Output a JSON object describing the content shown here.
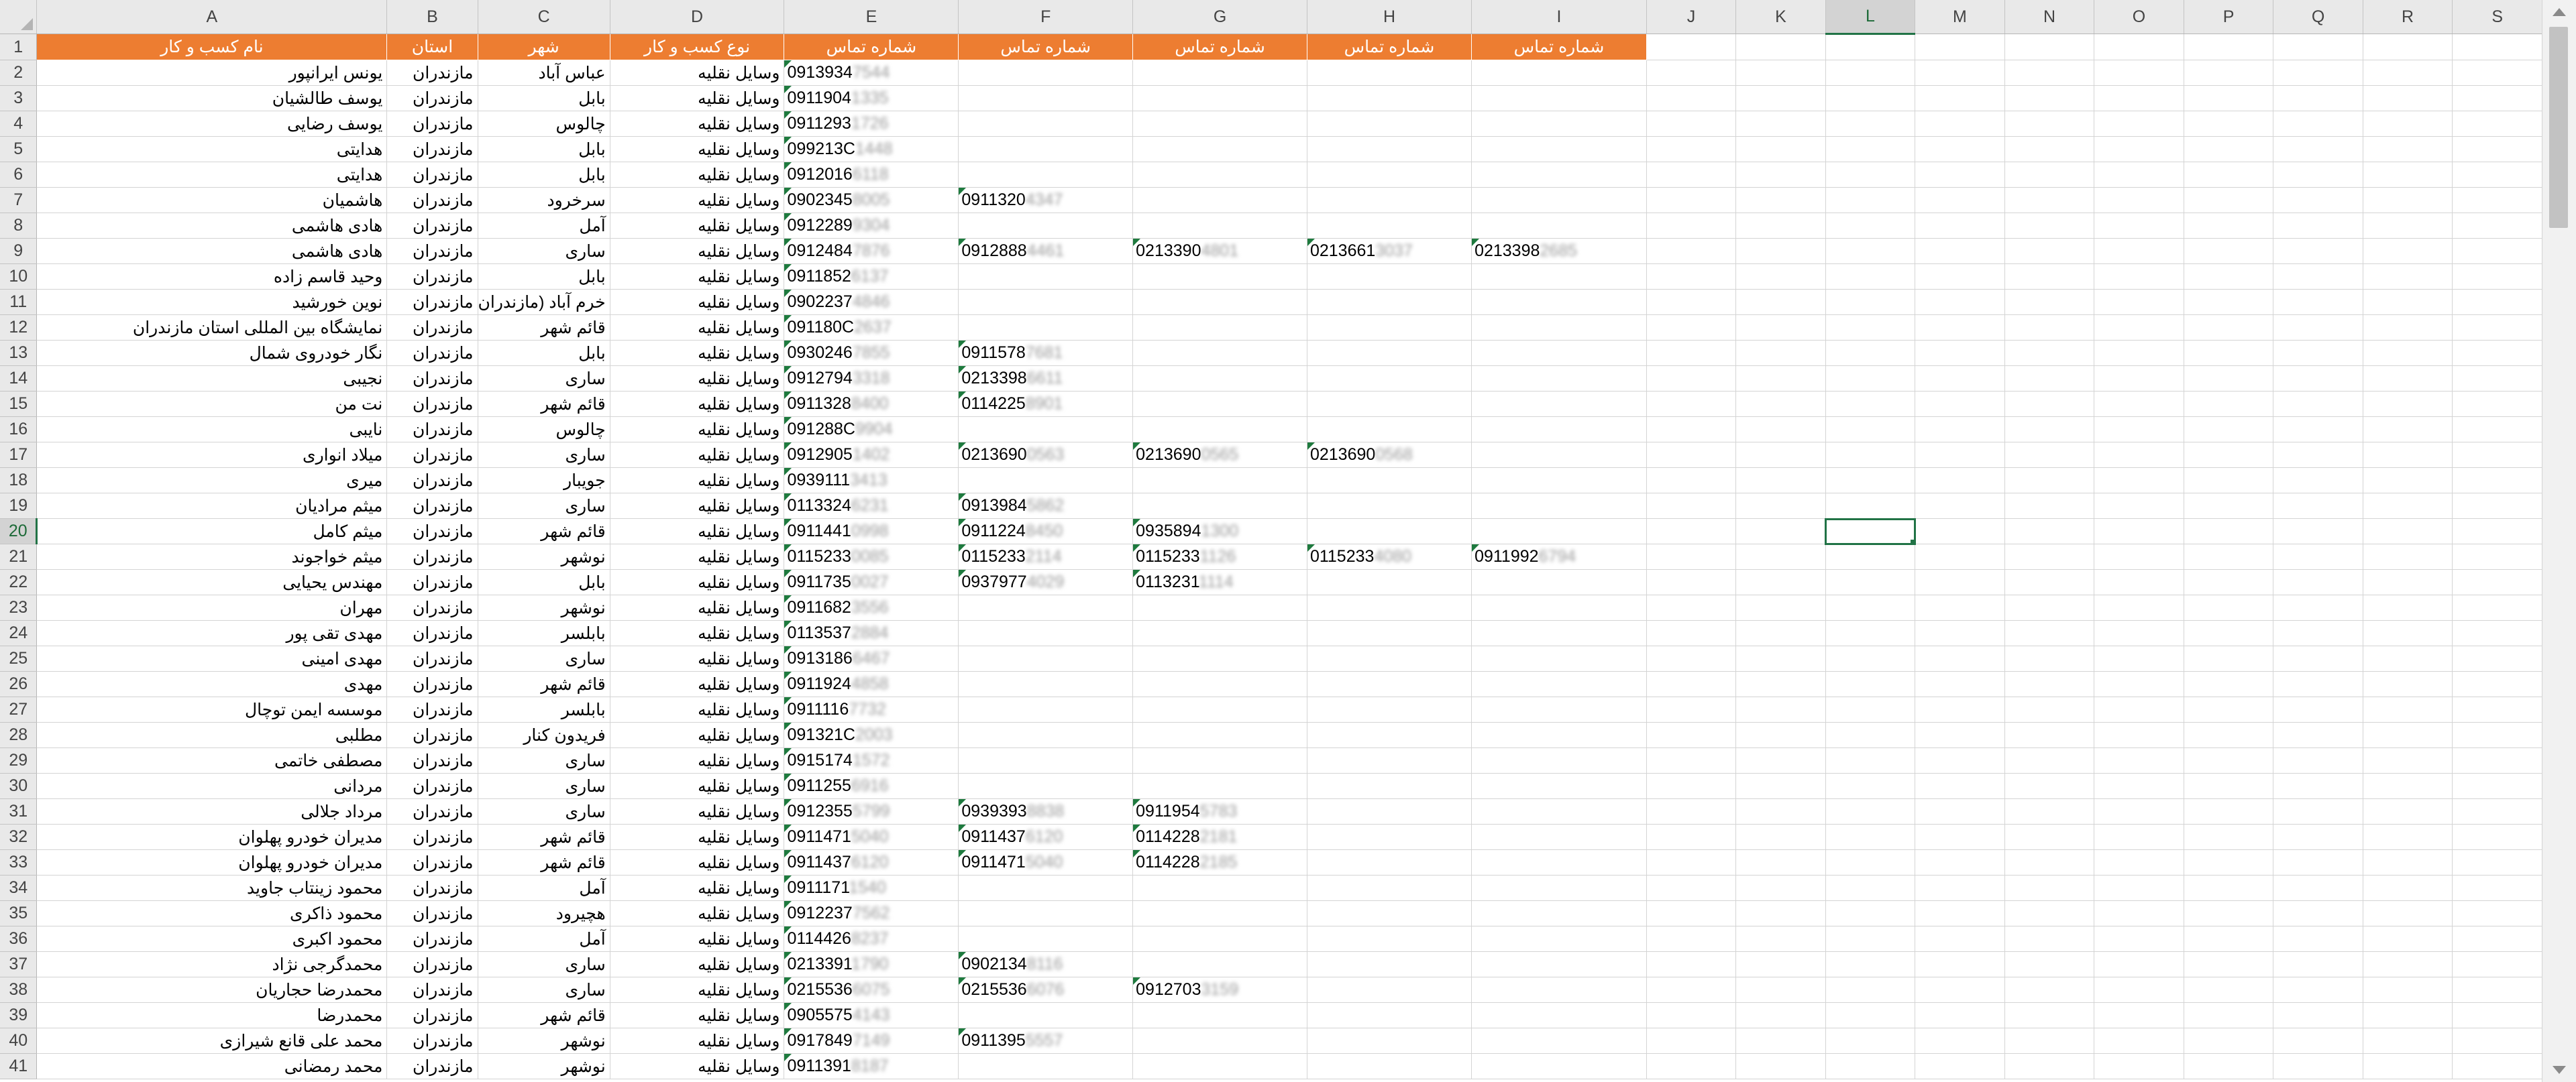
{
  "columns": [
    "A",
    "B",
    "C",
    "D",
    "E",
    "F",
    "G",
    "H",
    "I",
    "J",
    "K",
    "L",
    "M",
    "N",
    "O",
    "P",
    "Q",
    "R",
    "S"
  ],
  "active_column": "L",
  "active_row": "20",
  "header_row": {
    "A": "نام کسب و کار",
    "B": "استان",
    "C": "شهر",
    "D": "نوع کسب و کار",
    "E": "شماره تماس",
    "F": "شماره تماس",
    "G": "شماره تماس",
    "H": "شماره تماس",
    "I": "شماره تماس"
  },
  "rows": [
    {
      "n": "2",
      "A": "یونس ایرانپور",
      "B": "مازندران",
      "C": "عباس آباد",
      "D": "وسایل نقلیه",
      "E": "0913934",
      "Eb": "7544"
    },
    {
      "n": "3",
      "A": "یوسف طالشیان",
      "B": "مازندران",
      "C": "بابل",
      "D": "وسایل نقلیه",
      "E": "0911904",
      "Eb": "1335"
    },
    {
      "n": "4",
      "A": "یوسف رضایی",
      "B": "مازندران",
      "C": "چالوس",
      "D": "وسایل نقلیه",
      "E": "0911293",
      "Eb": "1726"
    },
    {
      "n": "5",
      "A": "هدایتی",
      "B": "مازندران",
      "C": "بابل",
      "D": "وسایل نقلیه",
      "E": "099213C",
      "Eb": "1448"
    },
    {
      "n": "6",
      "A": "هدایتی",
      "B": "مازندران",
      "C": "بابل",
      "D": "وسایل نقلیه",
      "E": "0912016",
      "Eb": "6118"
    },
    {
      "n": "7",
      "A": "هاشمیان",
      "B": "مازندران",
      "C": "سرخرود",
      "D": "وسایل نقلیه",
      "E": "0902345",
      "Eb": "8005",
      "F": "0911320",
      "Fb": "4347"
    },
    {
      "n": "8",
      "A": "هادی هاشمی",
      "B": "مازندران",
      "C": "آمل",
      "D": "وسایل نقلیه",
      "E": "0912289",
      "Eb": "9304"
    },
    {
      "n": "9",
      "A": "هادی هاشمی",
      "B": "مازندران",
      "C": "ساری",
      "D": "وسایل نقلیه",
      "E": "0912484",
      "Eb": "7876",
      "F": "0912888",
      "Fb": "4461",
      "G": "0213390",
      "Gb": "4801",
      "H": "0213661",
      "Hb": "3037",
      "I": "0213398",
      "Ib": "2685"
    },
    {
      "n": "10",
      "A": "وحید قاسم زاده",
      "B": "مازندران",
      "C": "بابل",
      "D": "وسایل نقلیه",
      "E": "0911852",
      "Eb": "6137"
    },
    {
      "n": "11",
      "A": "نوین خورشید",
      "B": "مازندران",
      "C": "خرم آباد (مازندران",
      "D": "وسایل نقلیه",
      "E": "0902237",
      "Eb": "4846"
    },
    {
      "n": "12",
      "A": "نمایشگاه بین المللی استان مازندران",
      "B": "مازندران",
      "C": "قائم شهر",
      "D": "وسایل نقلیه",
      "E": "091180C",
      "Eb": "2637"
    },
    {
      "n": "13",
      "A": "نگار خودروی شمال",
      "B": "مازندران",
      "C": "بابل",
      "D": "وسایل نقلیه",
      "E": "0930246",
      "Eb": "7855",
      "F": "0911578",
      "Fb": "7681"
    },
    {
      "n": "14",
      "A": "نجیبی",
      "B": "مازندران",
      "C": "ساری",
      "D": "وسایل نقلیه",
      "E": "0912794",
      "Eb": "3318",
      "F": "0213398",
      "Fb": "6611"
    },
    {
      "n": "15",
      "A": "نت من",
      "B": "مازندران",
      "C": "قائم شهر",
      "D": "وسایل نقلیه",
      "E": "0911328",
      "Eb": "8400",
      "F": "0114225",
      "Fb": "8901"
    },
    {
      "n": "16",
      "A": "نایبی",
      "B": "مازندران",
      "C": "چالوس",
      "D": "وسایل نقلیه",
      "E": "091288C",
      "Eb": "9904"
    },
    {
      "n": "17",
      "A": "میلاد انواری",
      "B": "مازندران",
      "C": "ساری",
      "D": "وسایل نقلیه",
      "E": "0912905",
      "Eb": "1402",
      "F": "0213690",
      "Fb": "0563",
      "G": "0213690",
      "Gb": "0565",
      "H": "0213690",
      "Hb": "0568"
    },
    {
      "n": "18",
      "A": "میری",
      "B": "مازندران",
      "C": "جویبار",
      "D": "وسایل نقلیه",
      "E": "0939111",
      "Eb": "3413"
    },
    {
      "n": "19",
      "A": "میثم مرادیان",
      "B": "مازندران",
      "C": "ساری",
      "D": "وسایل نقلیه",
      "E": "0113324",
      "Eb": "6231",
      "F": "0913984",
      "Fb": "5862"
    },
    {
      "n": "20",
      "A": "میثم کامل",
      "B": "مازندران",
      "C": "قائم شهر",
      "D": "وسایل نقلیه",
      "E": "0911441",
      "Eb": "0998",
      "F": "0911224",
      "Fb": "8450",
      "G": "0935894",
      "Gb": "1300"
    },
    {
      "n": "21",
      "A": "میثم خواجوند",
      "B": "مازندران",
      "C": "نوشهر",
      "D": "وسایل نقلیه",
      "E": "0115233",
      "Eb": "0085",
      "F": "0115233",
      "Fb": "2114",
      "G": "0115233",
      "Gb": "1126",
      "H": "0115233",
      "Hb": "4080",
      "I": "0911992",
      "Ib": "6794"
    },
    {
      "n": "22",
      "A": "مهندس یحیایی",
      "B": "مازندران",
      "C": "بابل",
      "D": "وسایل نقلیه",
      "E": "0911735",
      "Eb": "0027",
      "F": "0937977",
      "Fb": "4029",
      "G": "0113231",
      "Gb": "1114"
    },
    {
      "n": "23",
      "A": "مهران",
      "B": "مازندران",
      "C": "نوشهر",
      "D": "وسایل نقلیه",
      "E": "0911682",
      "Eb": "3556"
    },
    {
      "n": "24",
      "A": "مهدی تقی پور",
      "B": "مازندران",
      "C": "بابلسر",
      "D": "وسایل نقلیه",
      "E": "0113537",
      "Eb": "2884"
    },
    {
      "n": "25",
      "A": "مهدی امینی",
      "B": "مازندران",
      "C": "ساری",
      "D": "وسایل نقلیه",
      "E": "0913186",
      "Eb": "6467"
    },
    {
      "n": "26",
      "A": "مهدی",
      "B": "مازندران",
      "C": "قائم شهر",
      "D": "وسایل نقلیه",
      "E": "0911924",
      "Eb": "4858"
    },
    {
      "n": "27",
      "A": "موسسه ایمن توچال",
      "B": "مازندران",
      "C": "بابلسر",
      "D": "وسایل نقلیه",
      "E": "0911116",
      "Eb": "7732"
    },
    {
      "n": "28",
      "A": "مطلبی",
      "B": "مازندران",
      "C": "فریدون کنار",
      "D": "وسایل نقلیه",
      "E": "091321C",
      "Eb": "2003"
    },
    {
      "n": "29",
      "A": "مصطفی خاتمی",
      "B": "مازندران",
      "C": "ساری",
      "D": "وسایل نقلیه",
      "E": "0915174",
      "Eb": "1572"
    },
    {
      "n": "30",
      "A": "مردانی",
      "B": "مازندران",
      "C": "ساری",
      "D": "وسایل نقلیه",
      "E": "0911255",
      "Eb": "6916"
    },
    {
      "n": "31",
      "A": "مرداد جلالی",
      "B": "مازندران",
      "C": "ساری",
      "D": "وسایل نقلیه",
      "E": "0912355",
      "Eb": "5799",
      "F": "0939393",
      "Fb": "8838",
      "G": "0911954",
      "Gb": "5783"
    },
    {
      "n": "32",
      "A": "مدیران خودرو پهلوان",
      "B": "مازندران",
      "C": "قائم شهر",
      "D": "وسایل نقلیه",
      "E": "0911471",
      "Eb": "5040",
      "F": "0911437",
      "Fb": "6120",
      "G": "0114228",
      "Gb": "2181"
    },
    {
      "n": "33",
      "A": "مدیران خودرو پهلوان",
      "B": "مازندران",
      "C": "قائم شهر",
      "D": "وسایل نقلیه",
      "E": "0911437",
      "Eb": "6120",
      "F": "0911471",
      "Fb": "5040",
      "G": "0114228",
      "Gb": "2185"
    },
    {
      "n": "34",
      "A": "محمود زینتاب جاوید",
      "B": "مازندران",
      "C": "آمل",
      "D": "وسایل نقلیه",
      "E": "0911171",
      "Eb": "1540"
    },
    {
      "n": "35",
      "A": "محمود ذاکری",
      "B": "مازندران",
      "C": "هچیرود",
      "D": "وسایل نقلیه",
      "E": "0912237",
      "Eb": "7562"
    },
    {
      "n": "36",
      "A": "محمود اکبری",
      "B": "مازندران",
      "C": "آمل",
      "D": "وسایل نقلیه",
      "E": "0114426",
      "Eb": "8237"
    },
    {
      "n": "37",
      "A": "محمدگرجی نژاد",
      "B": "مازندران",
      "C": "ساری",
      "D": "وسایل نقلیه",
      "E": "0213391",
      "Eb": "1790",
      "F": "0902134",
      "Fb": "8116"
    },
    {
      "n": "38",
      "A": "محمدرضا حجاریان",
      "B": "مازندران",
      "C": "ساری",
      "D": "وسایل نقلیه",
      "E": "0215536",
      "Eb": "6075",
      "F": "0215536",
      "Fb": "6076",
      "G": "0912703",
      "Gb": "3159"
    },
    {
      "n": "39",
      "A": "محمدرضا",
      "B": "مازندران",
      "C": "قائم شهر",
      "D": "وسایل نقلیه",
      "E": "0905575",
      "Eb": "4143"
    },
    {
      "n": "40",
      "A": "محمد علی قانع شیرازی",
      "B": "مازندران",
      "C": "نوشهر",
      "D": "وسایل نقلیه",
      "E": "0917849",
      "Eb": "7149",
      "F": "0911395",
      "Fb": "5557"
    },
    {
      "n": "41",
      "A": "محمد رمضانی",
      "B": "مازندران",
      "C": "نوشهر",
      "D": "وسایل نقلیه",
      "E": "0911391",
      "Eb": "8187"
    }
  ],
  "colors": {
    "header_fill": "#ed7d31",
    "selection": "#217346",
    "grid": "#d4d4d4",
    "header_bg": "#e9e9e9"
  }
}
